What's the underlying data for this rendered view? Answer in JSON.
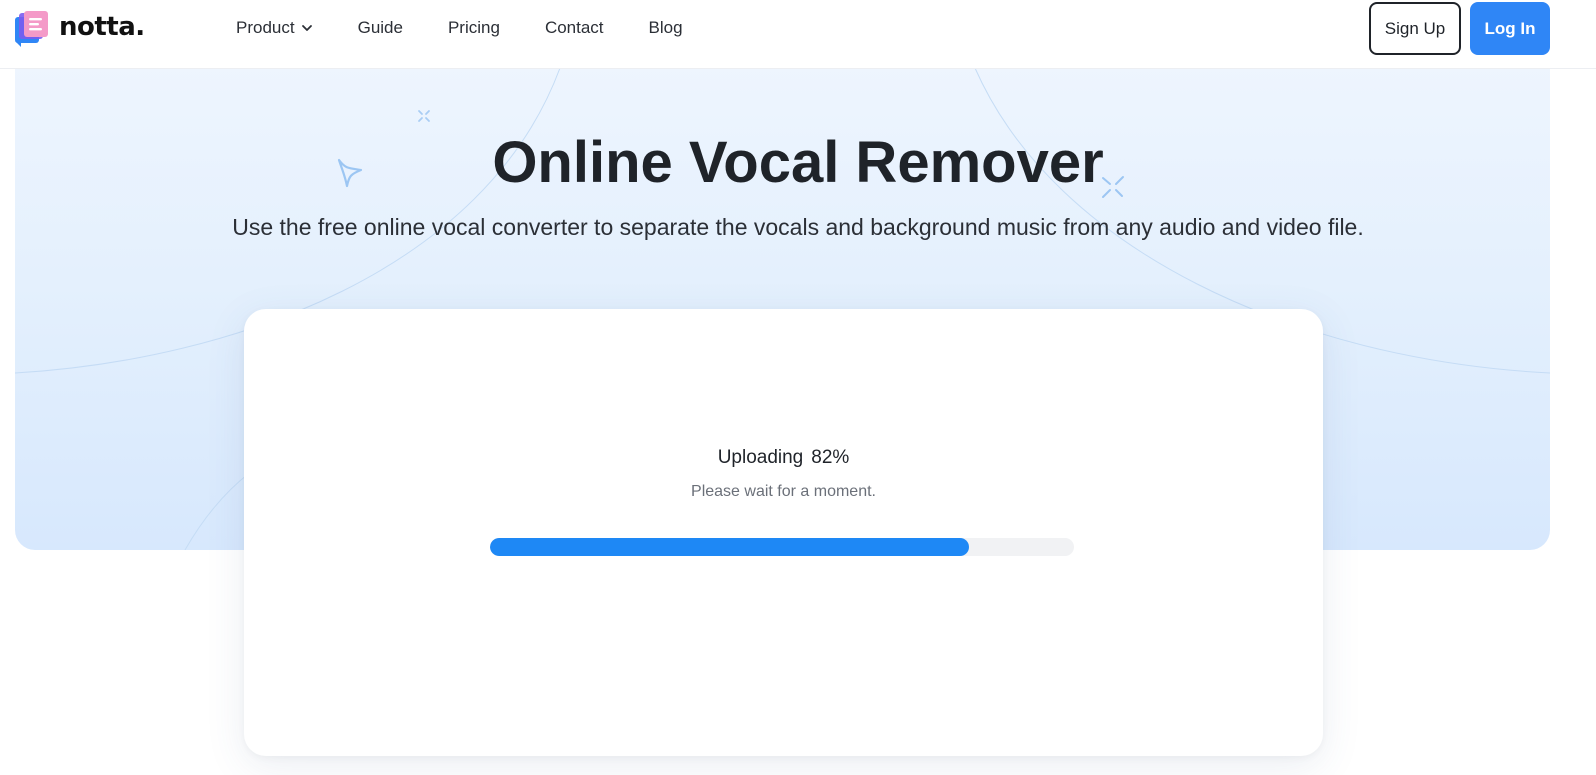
{
  "header": {
    "logo_text": "notta.",
    "nav": [
      {
        "label": "Product",
        "has_dropdown": true
      },
      {
        "label": "Guide"
      },
      {
        "label": "Pricing"
      },
      {
        "label": "Contact"
      },
      {
        "label": "Blog"
      }
    ],
    "signup_label": "Sign Up",
    "login_label": "Log In"
  },
  "hero": {
    "title": "Online Vocal Remover",
    "subtitle": "Use the free online vocal converter to separate the vocals and background music from any audio and video file."
  },
  "upload": {
    "status_label": "Uploading",
    "percent_text": "82%",
    "progress": 0.82,
    "hint": "Please wait for a moment."
  },
  "colors": {
    "accent": "#2f86f6",
    "progress": "#1e88f5",
    "hero_bg": "#e4f0fd"
  },
  "icons": {
    "logo": "notta-logo-icon",
    "dropdown": "chevron-down-icon",
    "sparkles": [
      "sparkle-star-icon",
      "sparkle-burst-icon"
    ]
  }
}
